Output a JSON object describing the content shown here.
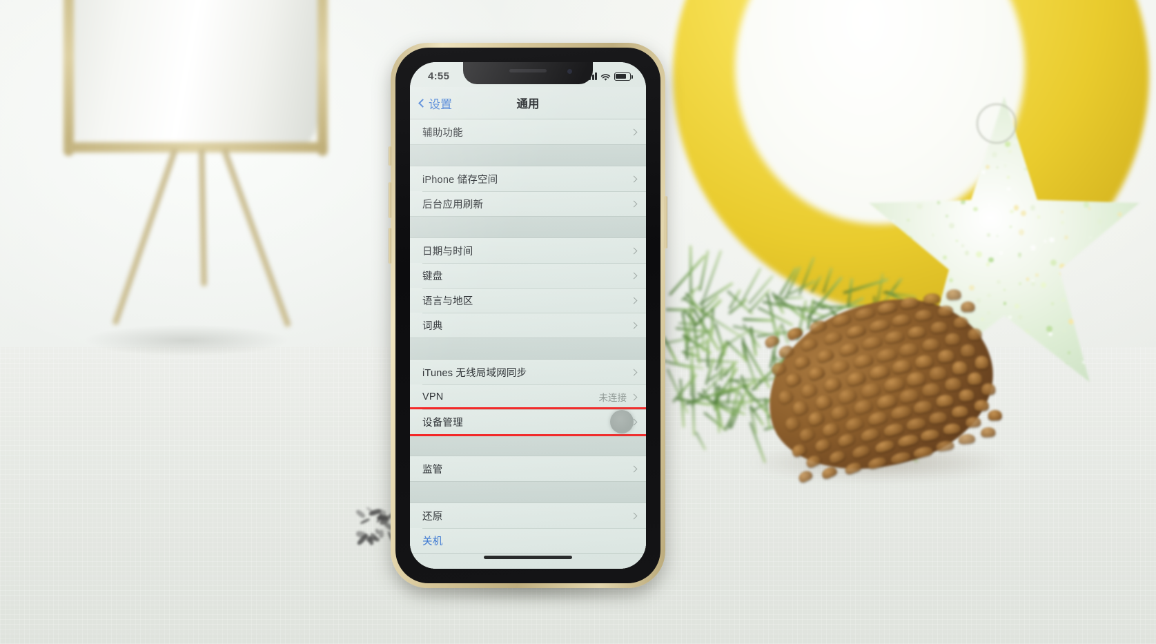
{
  "scene": {
    "description": "Photograph of an iPhone standing upright on a light cloth surface showing the iOS General settings screen, surrounded by holiday decorations",
    "objects": [
      {
        "name": "white-planter-with-gold-tripod",
        "position": "left-background"
      },
      {
        "name": "yellow-ring-ornament",
        "position": "right-background"
      },
      {
        "name": "glitter-star-ornament",
        "position": "far-right"
      },
      {
        "name": "pine-branch",
        "position": "right-middle"
      },
      {
        "name": "pine-cone",
        "position": "right-foreground"
      }
    ]
  },
  "phone": {
    "model_hint": "iPhone with notch, gold frame",
    "status_bar": {
      "time": "4:55",
      "cellular_icon": "signal-bars-icon",
      "cellular_bars": 4,
      "wifi_icon": "wifi-icon",
      "battery_icon": "battery-icon",
      "battery_level_percent": 72
    },
    "nav_bar": {
      "back_icon": "chevron-left-icon",
      "back_label": "设置",
      "title": "通用"
    },
    "home_indicator": "home-indicator"
  },
  "settings": {
    "groups": [
      {
        "id": "accessibility",
        "rows": [
          {
            "label": "辅助功能",
            "value": "",
            "accessory": "chevron-right-icon",
            "highlighted": false,
            "style": "default"
          }
        ]
      },
      {
        "id": "storage",
        "rows": [
          {
            "label": "iPhone 储存空间",
            "value": "",
            "accessory": "chevron-right-icon",
            "highlighted": false,
            "style": "default"
          },
          {
            "label": "后台应用刷新",
            "value": "",
            "accessory": "chevron-right-icon",
            "highlighted": false,
            "style": "default"
          }
        ]
      },
      {
        "id": "locale",
        "rows": [
          {
            "label": "日期与时间",
            "value": "",
            "accessory": "chevron-right-icon",
            "highlighted": false,
            "style": "default"
          },
          {
            "label": "键盘",
            "value": "",
            "accessory": "chevron-right-icon",
            "highlighted": false,
            "style": "default"
          },
          {
            "label": "语言与地区",
            "value": "",
            "accessory": "chevron-right-icon",
            "highlighted": false,
            "style": "default"
          },
          {
            "label": "词典",
            "value": "",
            "accessory": "chevron-right-icon",
            "highlighted": false,
            "style": "default"
          }
        ]
      },
      {
        "id": "network-management",
        "rows": [
          {
            "label": "iTunes 无线局域网同步",
            "value": "",
            "accessory": "chevron-right-icon",
            "highlighted": false,
            "style": "default"
          },
          {
            "label": "VPN",
            "value": "未连接",
            "accessory": "chevron-right-icon",
            "highlighted": false,
            "style": "default"
          },
          {
            "label": "设备管理",
            "value": "",
            "accessory": "chevron-right-icon",
            "highlighted": true,
            "style": "default"
          }
        ]
      },
      {
        "id": "supervision",
        "rows": [
          {
            "label": "监管",
            "value": "",
            "accessory": "chevron-right-icon",
            "highlighted": false,
            "style": "default"
          }
        ]
      },
      {
        "id": "reset",
        "rows": [
          {
            "label": "还原",
            "value": "",
            "accessory": "chevron-right-icon",
            "highlighted": false,
            "style": "default"
          },
          {
            "label": "关机",
            "value": "",
            "accessory": "",
            "highlighted": false,
            "style": "blue"
          }
        ]
      }
    ]
  },
  "annotation": {
    "highlight_color": "#f31a1a",
    "highlight_target": "设备管理",
    "touch_indicator": "touch-dot-icon"
  },
  "colors": {
    "accent_blue": "#2f6fd0",
    "screen_bg": "#dfe9e5",
    "row_bg": "#e2ebe7",
    "separator": "#c6d2cd",
    "value_text": "#8b9490",
    "label_text": "#22262a",
    "frame_gold": "#d8c89b",
    "ornament_yellow": "#f5dd4e"
  }
}
